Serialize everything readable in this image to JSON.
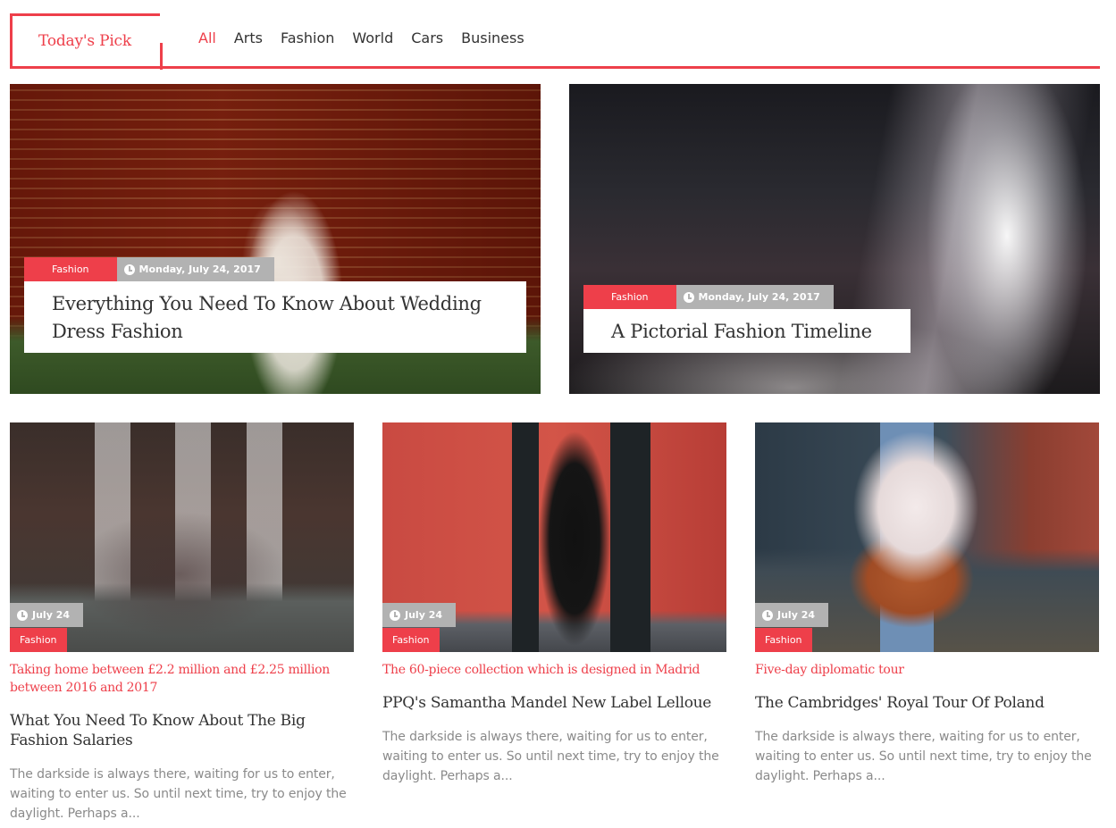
{
  "header": {
    "title": "Today's Pick",
    "nav": [
      "All",
      "Arts",
      "Fashion",
      "World",
      "Cars",
      "Business"
    ],
    "active_index": 0,
    "accent_color": "#ee3f4a"
  },
  "featured": [
    {
      "category": "Fashion",
      "date": "Monday, July 24, 2017",
      "title": "Everything You Need To Know About Wedding Dress Fashion"
    },
    {
      "category": "Fashion",
      "date": "Monday, July 24, 2017",
      "title": "A Pictorial Fashion Timeline"
    }
  ],
  "cards": [
    {
      "date": "July 24",
      "category": "Fashion",
      "kicker": "Taking home between £2.2 million and £2.25 million between 2016 and 2017",
      "title": "What You Need To Know About The Big Fashion Salaries",
      "excerpt": "The darkside is always there, waiting for us to enter, waiting to enter us. So until next time, try to enjoy the daylight. Perhaps a..."
    },
    {
      "date": "July 24",
      "category": "Fashion",
      "kicker": "The 60-piece collection which is designed in Madrid",
      "title": "PPQ's Samantha Mandel New Label Lelloue",
      "excerpt": "The darkside is always there, waiting for us to enter, waiting to enter us. So until next time, try to enjoy the daylight. Perhaps a..."
    },
    {
      "date": "July 24",
      "category": "Fashion",
      "kicker": "Five-day diplomatic tour",
      "title": "The Cambridges' Royal Tour Of Poland",
      "excerpt": "The darkside is always there, waiting for us to enter, waiting to enter us. So until next time, try to enjoy the daylight. Perhaps a..."
    }
  ],
  "icons": {
    "date": "clock-icon"
  }
}
